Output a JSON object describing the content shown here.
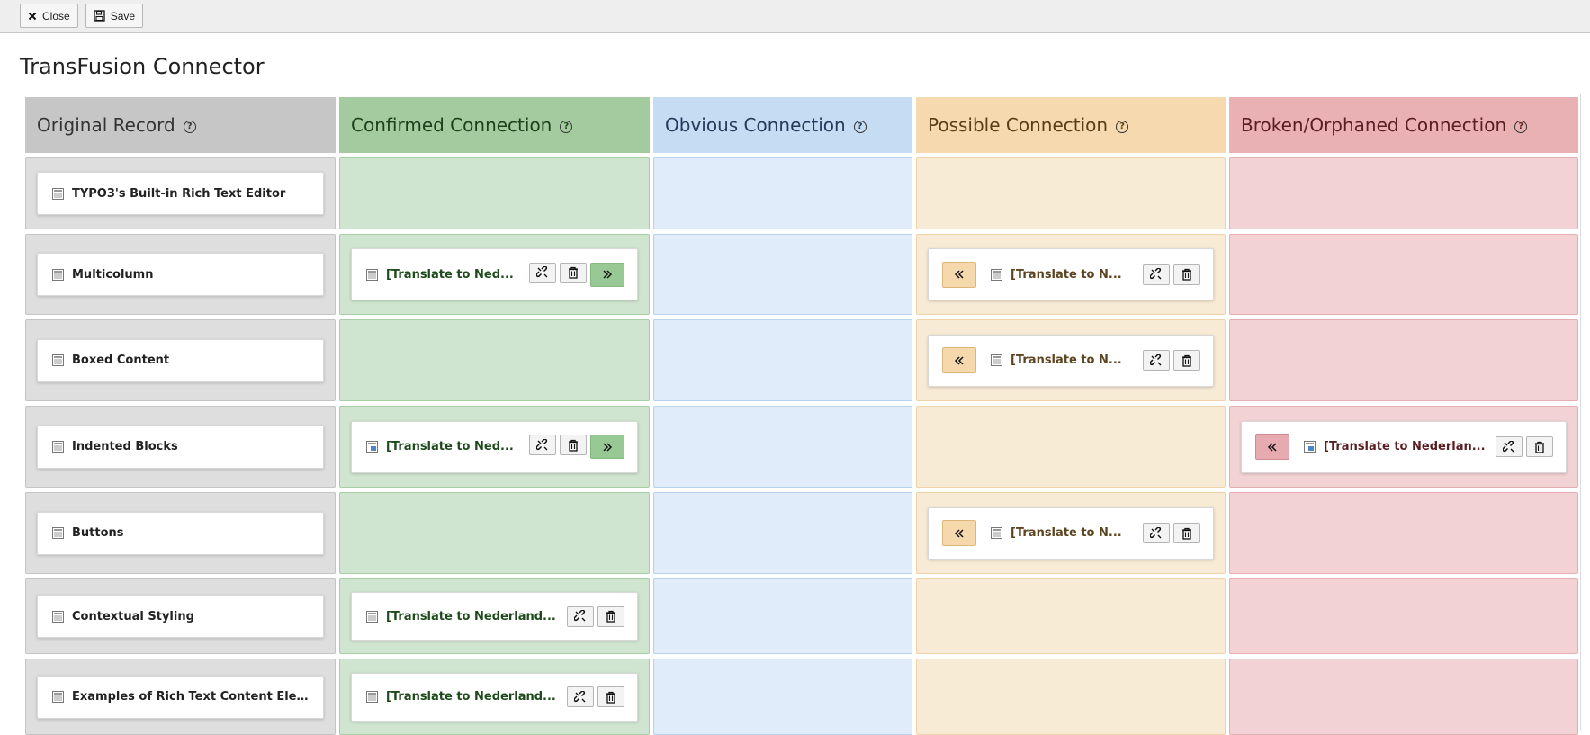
{
  "toolbar": {
    "close_label": "Close",
    "save_label": "Save"
  },
  "page": {
    "title": "TransFusion Connector"
  },
  "columns": {
    "original": "Original Record",
    "confirmed": "Confirmed Connection",
    "obvious": "Obvious Connection",
    "possible": "Possible Connection",
    "broken": "Broken/Orphaned Connection",
    "help_glyph": "?"
  },
  "rows": [
    {
      "original": "TYPO3's Built-in Rich Text Editor"
    },
    {
      "original": "Multicolumn",
      "confirmed": "[Translate to Ned...",
      "possible": "[Translate to N..."
    },
    {
      "original": "Boxed Content",
      "possible": "[Translate to N..."
    },
    {
      "original": "Indented Blocks",
      "confirmed": "[Translate to Ned...",
      "broken": "[Translate to Nederlan..."
    },
    {
      "original": "Buttons",
      "possible": "[Translate to N..."
    },
    {
      "original": "Contextual Styling",
      "confirmed": "[Translate to Nederland..."
    },
    {
      "original": "Examples of Rich Text Content Elem...",
      "confirmed": "[Translate to Nederland..."
    }
  ],
  "icons": {
    "close": "close-icon",
    "save": "save-icon",
    "doc": "content-element-icon",
    "unlink": "unlink-icon",
    "delete": "trash-icon",
    "move_right": "chevron-double-right-icon",
    "move_left": "chevron-double-left-icon"
  },
  "colors": {
    "original": "#c6c6c6",
    "confirmed": "#a3cb9f",
    "obvious": "#c6dcf3",
    "possible": "#f6d9ae",
    "broken": "#eab1b5"
  }
}
